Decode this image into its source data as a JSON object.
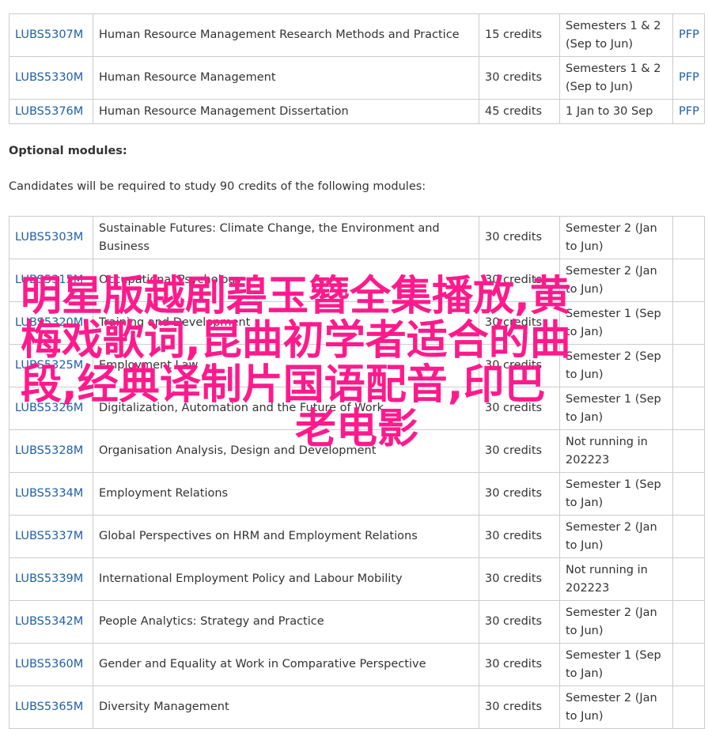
{
  "core_modules": [
    {
      "code": "LUBS5307M",
      "title": "Human Resource Management Research Methods and Practice",
      "credits": "15 credits",
      "term": "Semesters 1 & 2 (Sep to Jun)",
      "type": "PFP"
    },
    {
      "code": "LUBS5330M",
      "title": "Human Resource Management",
      "credits": "30 credits",
      "term": "Semesters 1 & 2 (Sep to Jun)",
      "type": "PFP"
    },
    {
      "code": "LUBS5376M",
      "title": "Human Resource Management Dissertation",
      "credits": "45 credits",
      "term": "1 Jan to 30 Sep",
      "type": "PFP"
    }
  ],
  "optional": {
    "heading": "Optional modules:",
    "intro": "Candidates will be required to study 90 credits of the following modules:"
  },
  "optional_modules": [
    {
      "code": "LUBS5303M",
      "title": "Sustainable Futures: Climate Change, the Environment and Business",
      "credits": "30 credits",
      "term": "Semester 2 (Jan to Jun)",
      "type": ""
    },
    {
      "code": "LUBS5315M",
      "title": "Occupational Psychology",
      "credits": "30 credits",
      "term": "Semester 2 (Jan to Jun)",
      "type": ""
    },
    {
      "code": "LUBS5320M",
      "title": "Training and Development",
      "credits": "30 credits",
      "term": "Semester 1 (Sep to Jan)",
      "type": ""
    },
    {
      "code": "LUBS5325M",
      "title": "Employment Law",
      "credits": "30 credits",
      "term": "Semester 2 (Sep to Jun)",
      "type": ""
    },
    {
      "code": "LUBS5326M",
      "title": "Digitalization, Automation and the Future of Work",
      "credits": "30 credits",
      "term": "Semester 1 (Sep to Jan)",
      "type": ""
    },
    {
      "code": "LUBS5328M",
      "title": "Organisation Analysis, Design and Development",
      "credits": "30 credits",
      "term": "Not running in 202223",
      "type": ""
    },
    {
      "code": "LUBS5334M",
      "title": "Employment Relations",
      "credits": "30 credits",
      "term": "Semester 1 (Sep to Jan)",
      "type": ""
    },
    {
      "code": "LUBS5337M",
      "title": "Global Perspectives on HRM and Employment Relations",
      "credits": "30 credits",
      "term": "Semester 2 (Jan to Jun)",
      "type": ""
    },
    {
      "code": "LUBS5339M",
      "title": "International Employment Policy and Labour Mobility",
      "credits": "30 credits",
      "term": "Not running in 202223",
      "type": ""
    },
    {
      "code": "LUBS5342M",
      "title": "People Analytics: Strategy and Practice",
      "credits": "30 credits",
      "term": "Semester 2 (Jan to Jun)",
      "type": ""
    },
    {
      "code": "LUBS5360M",
      "title": "Gender and Equality at Work in Comparative Perspective",
      "credits": "30 credits",
      "term": "Semester 1 (Sep to Jan)",
      "type": ""
    },
    {
      "code": "LUBS5365M",
      "title": "Diversity Management",
      "credits": "30 credits",
      "term": "Semester 2 (Jan to Jun)",
      "type": ""
    }
  ],
  "overlay": {
    "line1": "明星版越剧碧玉簪全集播放,黄",
    "line2": "梅戏歌词,昆曲初学者适合的曲",
    "line3": "段,经典译制片国语配音,印巴",
    "line4": "老电影",
    "color": "#ff1a8c"
  },
  "colors": {
    "link": "#1f5fa6",
    "border": "#cccccc",
    "text": "#333333"
  }
}
